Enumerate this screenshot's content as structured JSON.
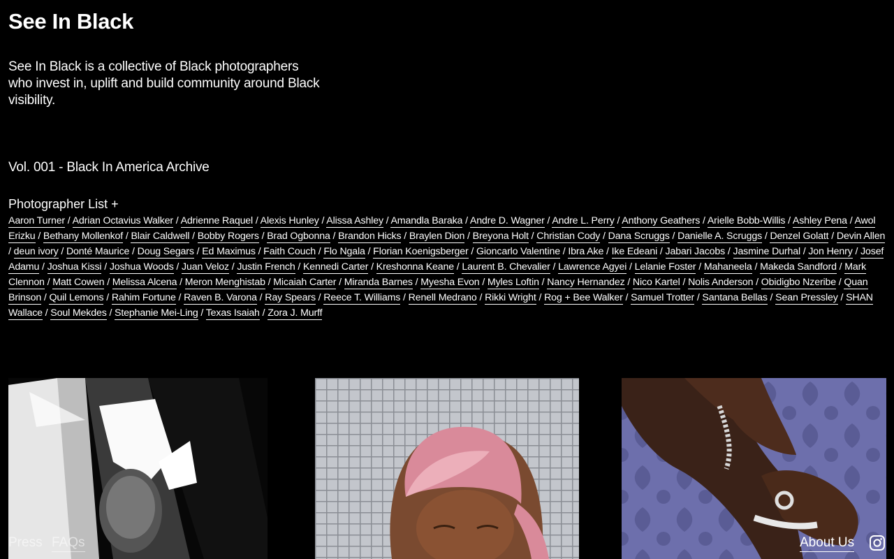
{
  "site": {
    "title": "See In Black",
    "tagline": "See In Black is a collective of Black photographers who invest in, uplift and build community around Black visibility.",
    "volume": "Vol. 001 - Black In America Archive"
  },
  "photographers": {
    "heading": "Photographer List +",
    "separator": " / ",
    "names": [
      "Aaron Turner",
      "Adrian Octavius Walker",
      "Adrienne Raquel",
      "Alexis Hunley",
      "Alissa Ashley",
      "Amandla Baraka",
      "Andre D. Wagner",
      "Andre L. Perry",
      "Anthony Geathers",
      "Arielle Bobb-Willis",
      "Ashley Pena",
      "Awol Erizku",
      "Bethany Mollenkof",
      "Blair Caldwell",
      "Bobby Rogers",
      "Brad Ogbonna",
      "Brandon Hicks",
      "Braylen Dion",
      "Breyona Holt",
      "Christian Cody",
      "Dana Scruggs",
      "Danielle A. Scruggs",
      "Denzel Golatt",
      "Devin Allen",
      "deun ivory",
      "Donté Maurice",
      "Doug Segars",
      "Ed Maximus",
      "Faith Couch",
      "Flo Ngala",
      "Florian Koenigsberger",
      "Gioncarlo Valentine",
      "Ibra Ake",
      "Ike Edeani",
      "Jabari Jacobs",
      "Jasmine Durhal",
      "Jon Henry",
      "Josef Adamu",
      "Joshua Kissi",
      "Joshua Woods",
      "Juan Veloz",
      "Justin French",
      "Kennedi Carter",
      "Kreshonna Keane",
      "Laurent B. Chevalier",
      "Lawrence Agyei",
      "Lelanie Foster",
      "Mahaneela",
      "Makeda Sandford",
      "Mark Clennon",
      "Matt Cowen",
      "Melissa Alcena",
      "Meron Menghistab",
      "Micaiah Carter",
      "Miranda Barnes",
      "Myesha Evon",
      "Myles Loftin",
      "Nancy Hernandez",
      "Nico Kartel",
      "Nolis Anderson",
      "Obidigbo Nzeribe",
      "Quan Brinson",
      "Quil Lemons",
      "Rahim Fortune",
      "Raven B. Varona",
      "Ray Spears",
      "Reece T. Williams",
      "Renell Medrano",
      "Rikki Wright",
      "Rog + Bee Walker",
      "Samuel Trotter",
      "Santana Bellas",
      "Sean Pressley",
      "SHAN Wallace",
      "Soul Mekdes",
      "Stephanie Mei-Ling",
      "Texas Isaiah",
      "Zora J. Murff"
    ]
  },
  "footer": {
    "press_label": "Press",
    "faqs_label": "FAQs",
    "about_label": "About Us",
    "instagram_icon": "instagram-icon"
  },
  "colors": {
    "background": "#000000",
    "text": "#ffffff"
  }
}
